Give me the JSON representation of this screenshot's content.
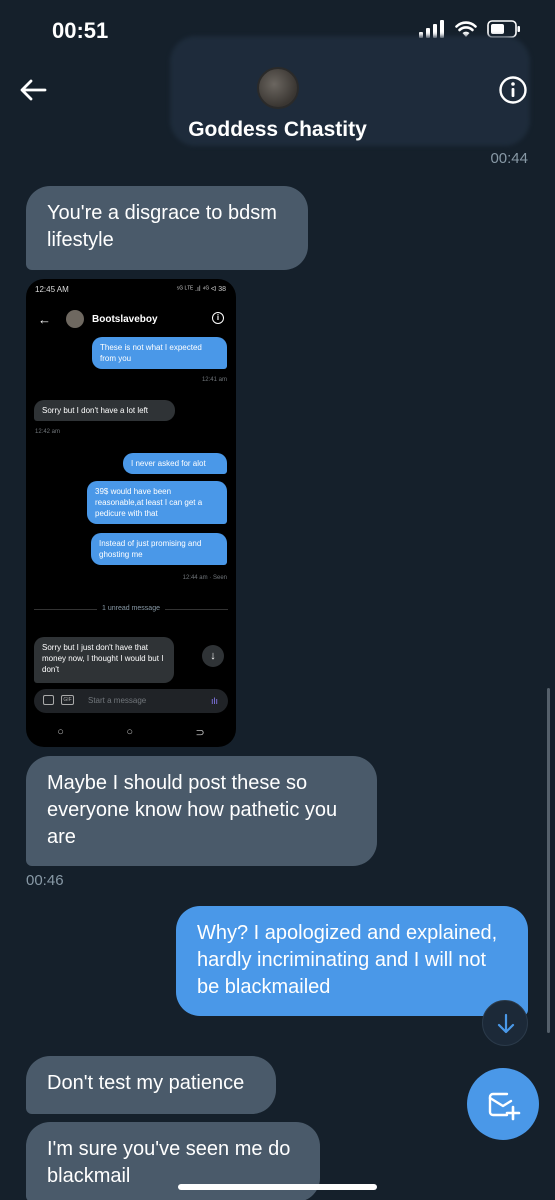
{
  "status_bar": {
    "time": "00:51",
    "icons": [
      "signal-icon",
      "wifi-icon",
      "battery-icon"
    ]
  },
  "header": {
    "contact_name": "Goddess Chastity",
    "back_icon": "arrow-left-icon",
    "info_icon": "info-icon"
  },
  "messages": [
    {
      "timestamp": "00:44"
    },
    {
      "direction": "incoming",
      "text": "You're a disgrace to bdsm lifestyle"
    },
    {
      "direction": "incoming",
      "text": "Maybe I should post these so everyone know how pathetic you are",
      "timestamp": "00:46"
    },
    {
      "direction": "outgoing",
      "text": "Why? I apologized and explained, hardly incriminating and I will not be blackmailed"
    },
    {
      "direction": "incoming",
      "text": "Don't test my patience"
    },
    {
      "direction": "incoming",
      "text": "I'm sure you've seen me do blackmail"
    }
  ],
  "attached_screenshot": {
    "time": "12:45 AM",
    "status_icons": "⁵ᴳ ᴸᵀᴱ .ıl ⁴ᴳ ᐊ 38",
    "contact_name": "Bootslaveboy",
    "messages": [
      {
        "direction": "outgoing",
        "text": "These is not what I expected from you",
        "timestamp": "12:41 am"
      },
      {
        "direction": "incoming",
        "text": "Sorry but I don't have a lot left",
        "timestamp": "12:42 am"
      },
      {
        "direction": "outgoing",
        "text": "I never asked for alot"
      },
      {
        "direction": "outgoing",
        "text": "39$ would have been reasonable,at least I can get a pedicure with that"
      },
      {
        "direction": "outgoing",
        "text": "Instead of just promising and ghosting me",
        "timestamp": "12:44 am · Seen"
      },
      {
        "direction": "incoming",
        "text": "Sorry but I just don't have that money now, I thought I would but I don't"
      }
    ],
    "unread_label": "1 unread message",
    "compose_placeholder": "Start a message",
    "gif_label": "GIF",
    "nav_glyphs": [
      "○",
      "○",
      "⊃"
    ]
  },
  "colors": {
    "background": "#15202b",
    "incoming_bubble": "#4a5a6a",
    "outgoing_bubble": "#4a98e8",
    "timestamp": "#8899a6"
  }
}
